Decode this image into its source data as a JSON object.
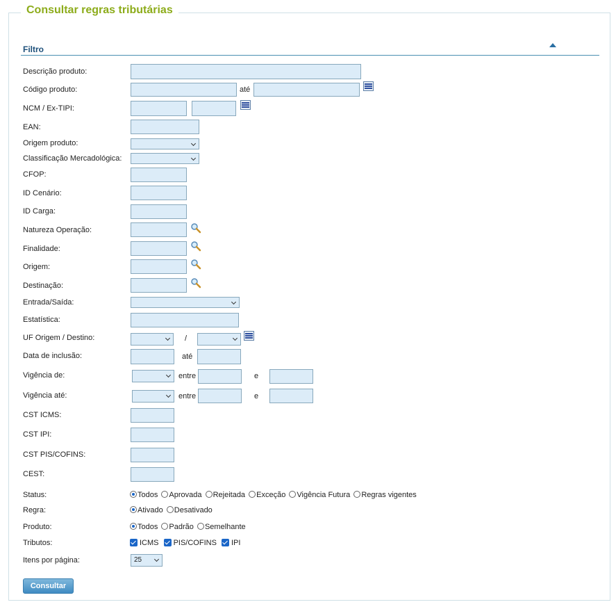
{
  "page_title": "Consultar regras tributárias",
  "filter_title": "Filtro",
  "labels": {
    "descricao": "Descrição produto:",
    "codigo": "Código produto:",
    "ncm": "NCM / Ex-TIPI:",
    "ean": "EAN:",
    "origem_produto": "Origem produto:",
    "classificacao": "Classificação Mercadológica:",
    "cfop": "CFOP:",
    "id_cenario": "ID Cenário:",
    "id_carga": "ID Carga:",
    "natureza": "Natureza Operação:",
    "finalidade": "Finalidade:",
    "origem": "Origem:",
    "destinacao": "Destinação:",
    "entrada_saida": "Entrada/Saída:",
    "estatistica": "Estatística:",
    "uf": "UF Origem / Destino:",
    "data_inclusao": "Data de inclusão:",
    "vigencia_de": "Vigência de:",
    "vigencia_ate": "Vigência até:",
    "cst_icms": "CST ICMS:",
    "cst_ipi": "CST IPI:",
    "cst_pis": "CST PIS/COFINS:",
    "cest": "CEST:",
    "status": "Status:",
    "regra": "Regra:",
    "produto": "Produto:",
    "tributos": "Tributos:",
    "itens": "Itens por página:"
  },
  "connectors": {
    "ate": "até",
    "slash": "/",
    "entre": "entre",
    "e": "e"
  },
  "status_options": [
    "Todos",
    "Aprovada",
    "Rejeitada",
    "Exceção",
    "Vigência Futura",
    "Regras vigentes"
  ],
  "status_selected": "Todos",
  "regra_options": [
    "Ativado",
    "Desativado"
  ],
  "regra_selected": "Ativado",
  "produto_options": [
    "Todos",
    "Padrão",
    "Semelhante"
  ],
  "produto_selected": "Todos",
  "tributos": [
    {
      "label": "ICMS",
      "checked": true
    },
    {
      "label": "PIS/COFINS",
      "checked": true
    },
    {
      "label": "IPI",
      "checked": true
    }
  ],
  "itens_por_pagina": "25",
  "submit_label": "Consultar",
  "colors": {
    "title": "#8dac1b",
    "input_bg": "#dcecf8",
    "button": "#3f8bc2"
  },
  "icons": {
    "list": "list-icon",
    "search": "magnifier-icon",
    "collapse": "triangle-up-icon"
  }
}
